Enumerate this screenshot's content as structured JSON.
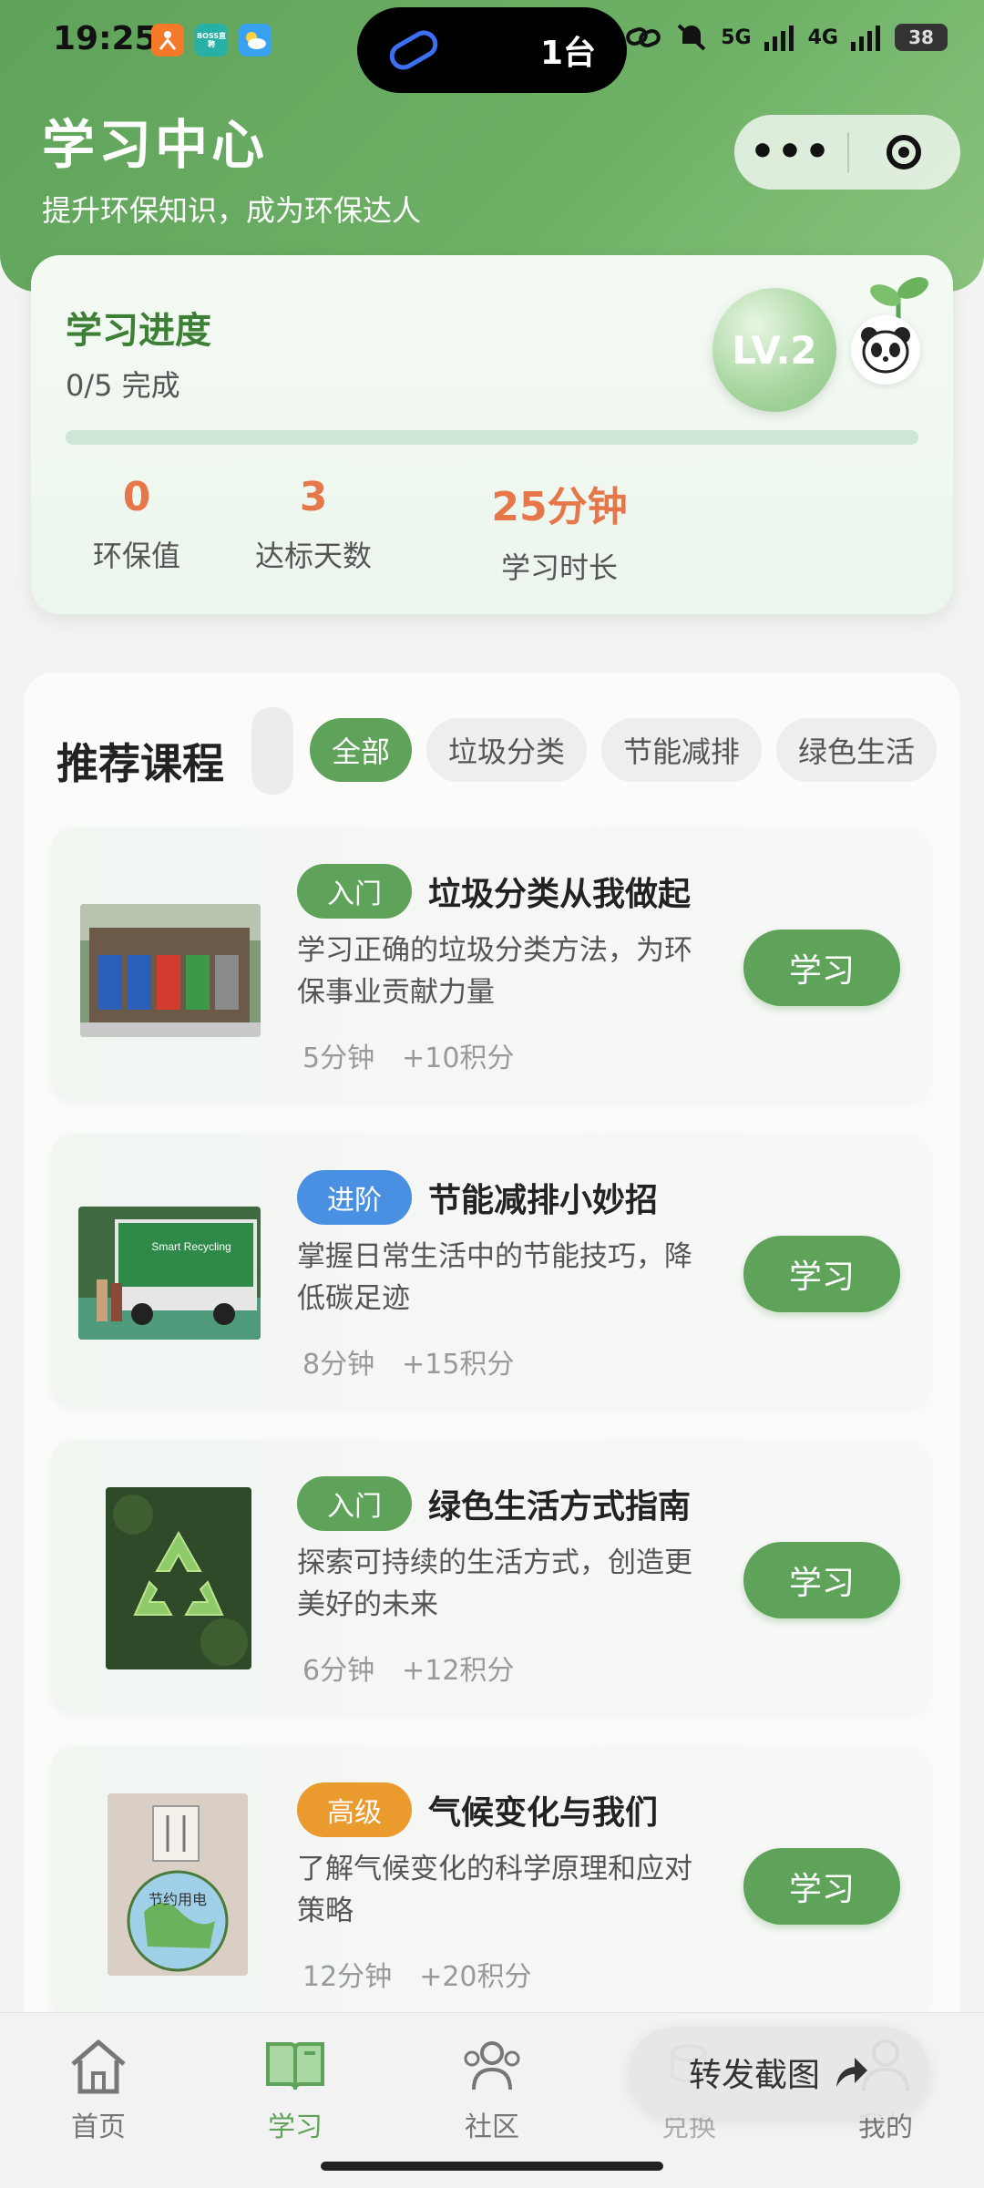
{
  "status": {
    "time": "19:25",
    "island_text": "1台",
    "network_labels": [
      "5G",
      "4G"
    ],
    "battery": "38",
    "apps": [
      "BOSS直聘"
    ]
  },
  "header": {
    "title": "学习中心",
    "subtitle": "提升环保知识，成为环保达人"
  },
  "progress": {
    "title": "学习进度",
    "completed_text": "0/5 完成",
    "level": "LV.2",
    "fraction": 0,
    "stats": [
      {
        "value": "0",
        "label": "环保值"
      },
      {
        "value": "3",
        "label": "达标天数"
      },
      {
        "value": "25分钟",
        "label": "学习时长"
      }
    ]
  },
  "recommend": {
    "title": "推荐课程",
    "tabs": [
      "全部",
      "垃圾分类",
      "节能减排",
      "绿色生活"
    ],
    "active_tab": 0
  },
  "courses": [
    {
      "level": "入门",
      "level_color": "#5fa25a",
      "title": "垃圾分类从我做起",
      "desc": "学习正确的垃圾分类方法，为环保事业贡献力量",
      "duration": "5分钟",
      "points": "+10积分",
      "button": "学习"
    },
    {
      "level": "进阶",
      "level_color": "#4a90e2",
      "title": "节能减排小妙招",
      "desc": "掌握日常生活中的节能技巧，降低碳足迹",
      "duration": "8分钟",
      "points": "+15积分",
      "button": "学习"
    },
    {
      "level": "入门",
      "level_color": "#5fa25a",
      "title": "绿色生活方式指南",
      "desc": "探索可持续的生活方式，创造更美好的未来",
      "duration": "6分钟",
      "points": "+12积分",
      "button": "学习"
    },
    {
      "level": "高级",
      "level_color": "#eb9a2e",
      "title": "气候变化与我们",
      "desc": "了解气候变化的科学原理和应对策略",
      "duration": "12分钟",
      "points": "+20积分",
      "button": "学习"
    }
  ],
  "thumb_texts": {
    "recycling_truck": "Smart Recycling",
    "sign": "节约用电"
  },
  "tabbar": {
    "items": [
      {
        "label": "首页",
        "icon": "home-icon"
      },
      {
        "label": "学习",
        "icon": "book-icon"
      },
      {
        "label": "社区",
        "icon": "community-icon"
      },
      {
        "label": "兑换",
        "icon": "exchange-icon"
      },
      {
        "label": "我的",
        "icon": "profile-icon"
      }
    ],
    "active": 1,
    "share_label": "转发截图"
  },
  "colors": {
    "primary": "#5fa25a",
    "accent_orange": "#e5774a",
    "blue": "#4a90e2",
    "gold": "#eb9a2e"
  }
}
